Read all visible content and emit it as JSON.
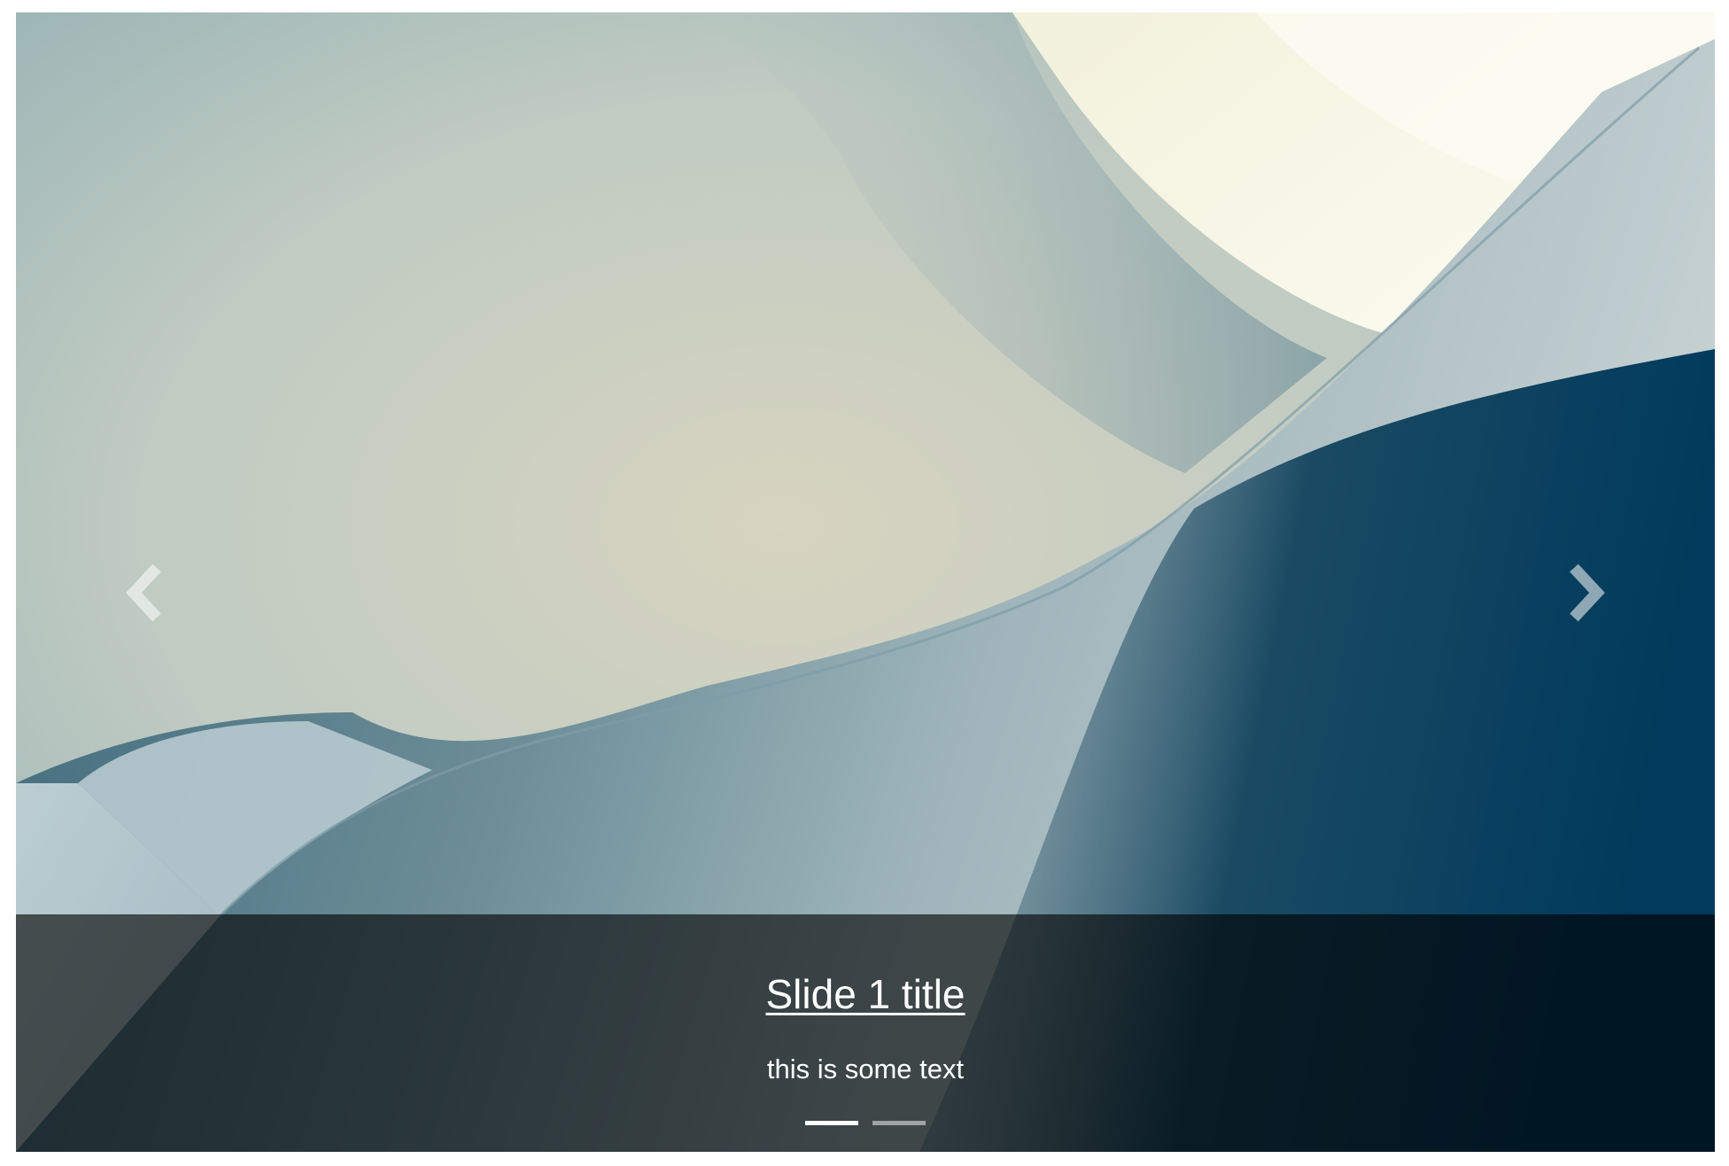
{
  "carousel": {
    "slides": [
      {
        "title": "Slide 1 title",
        "text": "this is some text",
        "active": true
      },
      {
        "active": false
      }
    ],
    "controls": {
      "prev_icon": "chevron-left-icon",
      "next_icon": "chevron-right-icon"
    },
    "caption_overlay_color": "rgba(0,0,0,0.62)"
  },
  "colors": {
    "caption_text": "#ffffff",
    "indicator_active": "#ffffff",
    "background": "#ffffff"
  }
}
